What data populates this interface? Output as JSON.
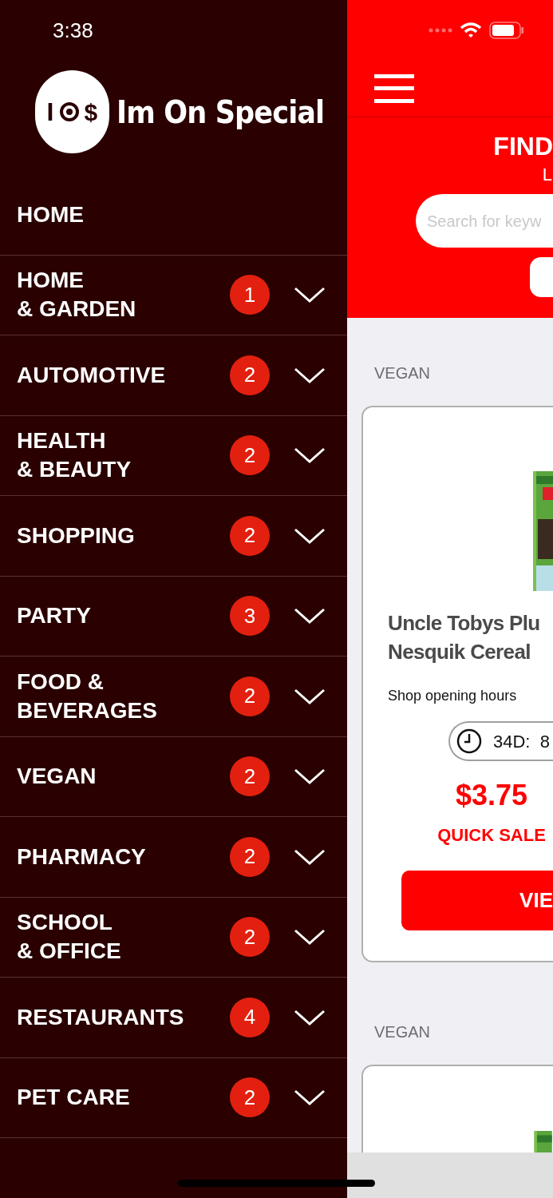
{
  "status_bar": {
    "time": "3:38"
  },
  "logo": {
    "mark_left": "I",
    "mark_right": "$",
    "name": "Im On Special"
  },
  "menu": [
    {
      "kind": "link",
      "label": "HOME"
    },
    {
      "kind": "category",
      "label": "HOME\n& GARDEN",
      "count": "1",
      "expanded": false
    },
    {
      "kind": "category",
      "label": "AUTOMOTIVE",
      "count": "2",
      "expanded": false
    },
    {
      "kind": "category",
      "label": "HEALTH\n& BEAUTY",
      "count": "2",
      "expanded": false
    },
    {
      "kind": "category",
      "label": "SHOPPING",
      "count": "2",
      "expanded": false
    },
    {
      "kind": "category",
      "label": "PARTY",
      "count": "3",
      "expanded": false
    },
    {
      "kind": "category",
      "label": "FOOD &\nBEVERAGES",
      "count": "2",
      "expanded": false
    },
    {
      "kind": "category",
      "label": "VEGAN",
      "count": "2",
      "expanded": false
    },
    {
      "kind": "category",
      "label": "PHARMACY",
      "count": "2",
      "expanded": false
    },
    {
      "kind": "category",
      "label": "SCHOOL\n& OFFICE",
      "count": "2",
      "expanded": false
    },
    {
      "kind": "category",
      "label": "RESTAURANTS",
      "count": "4",
      "expanded": false
    },
    {
      "kind": "category",
      "label": "PET CARE",
      "count": "2",
      "expanded": false
    }
  ],
  "header": {
    "title": "FIND",
    "subtitle": "L",
    "search": {
      "placeholder": "Search for keyw"
    }
  },
  "sections": [
    {
      "heading": "VEGAN",
      "card": {
        "kind": "full",
        "title": "Uncle Tobys Plu\nNesquik Cereal",
        "hours_label": "Shop opening hours",
        "timer": "34D:  8",
        "price": "$3.75",
        "tag": "QUICK SALE",
        "button": "VIE"
      }
    },
    {
      "heading": "VEGAN",
      "card": {
        "kind": "partial"
      }
    }
  ]
}
